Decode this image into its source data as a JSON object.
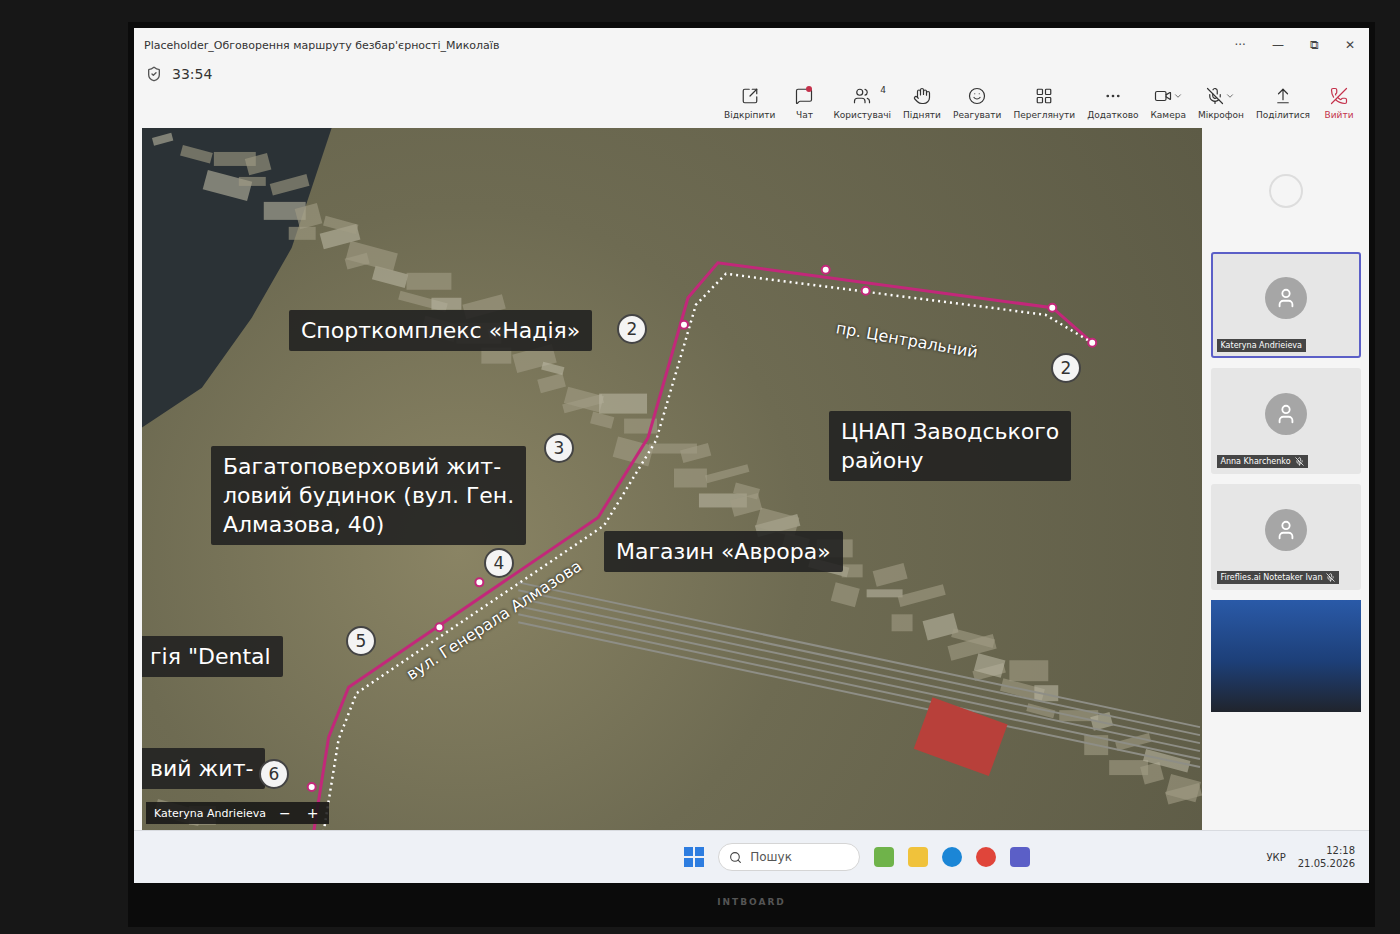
{
  "window": {
    "title": "Placeholder_Обговорення маршруту безбар'єрності_Миколаїв",
    "controls": [
      "···",
      "—",
      "⧉",
      "✕"
    ]
  },
  "call": {
    "timer": "33:54"
  },
  "toolbar": [
    {
      "label": "Відкріпити",
      "kind": "button"
    },
    {
      "label": "Чат",
      "kind": "button",
      "notification": true
    },
    {
      "label": "Користувачі",
      "kind": "button",
      "badge": "4"
    },
    {
      "label": "Підняти",
      "kind": "button"
    },
    {
      "label": "Реагувати",
      "kind": "button"
    },
    {
      "label": "Переглянути",
      "kind": "button"
    },
    {
      "label": "Додатково",
      "kind": "button"
    },
    {
      "label": "Камера",
      "kind": "split"
    },
    {
      "label": "Мікрофон",
      "kind": "split",
      "muted": true
    },
    {
      "label": "Поділитися",
      "kind": "button"
    },
    {
      "label": "Вийти",
      "kind": "leave"
    }
  ],
  "map": {
    "labels": [
      {
        "text": "Спорткомплекс «Надія»"
      },
      {
        "text": "Багатоповерховий жит-\nловий будинок (вул. Ген.\nАлмазова, 40)"
      },
      {
        "text": "ЦНАП Заводського\nрайону"
      },
      {
        "text": "Магазин «Аврора»"
      },
      {
        "text": "гія \"Dental"
      },
      {
        "text": "вий жит-"
      }
    ],
    "streets": [
      {
        "text": "пр. Центральний"
      },
      {
        "text": "вул. Генерала Алмазова"
      }
    ],
    "pins": [
      {
        "number": "2"
      },
      {
        "number": "2"
      },
      {
        "number": "3"
      },
      {
        "number": "4"
      },
      {
        "number": "5"
      },
      {
        "number": "6"
      }
    ],
    "name_tag": {
      "name": "Kateryna Andrieieva",
      "zoom_out": "−",
      "zoom_in": "+"
    }
  },
  "participants": [
    {
      "name": "Kateryna Andrieieva",
      "muted": false,
      "selected": true
    },
    {
      "name": "Anna Kharchenko",
      "muted": true,
      "selected": false
    },
    {
      "name": "Fireflies.ai Notetaker Ivan",
      "muted": true,
      "selected": false
    }
  ],
  "taskbar": {
    "search": "Пошук",
    "language": "УКР",
    "time": "12:18",
    "date": "21.05.2026"
  },
  "bezel": {
    "brand": "INTBOARD"
  }
}
